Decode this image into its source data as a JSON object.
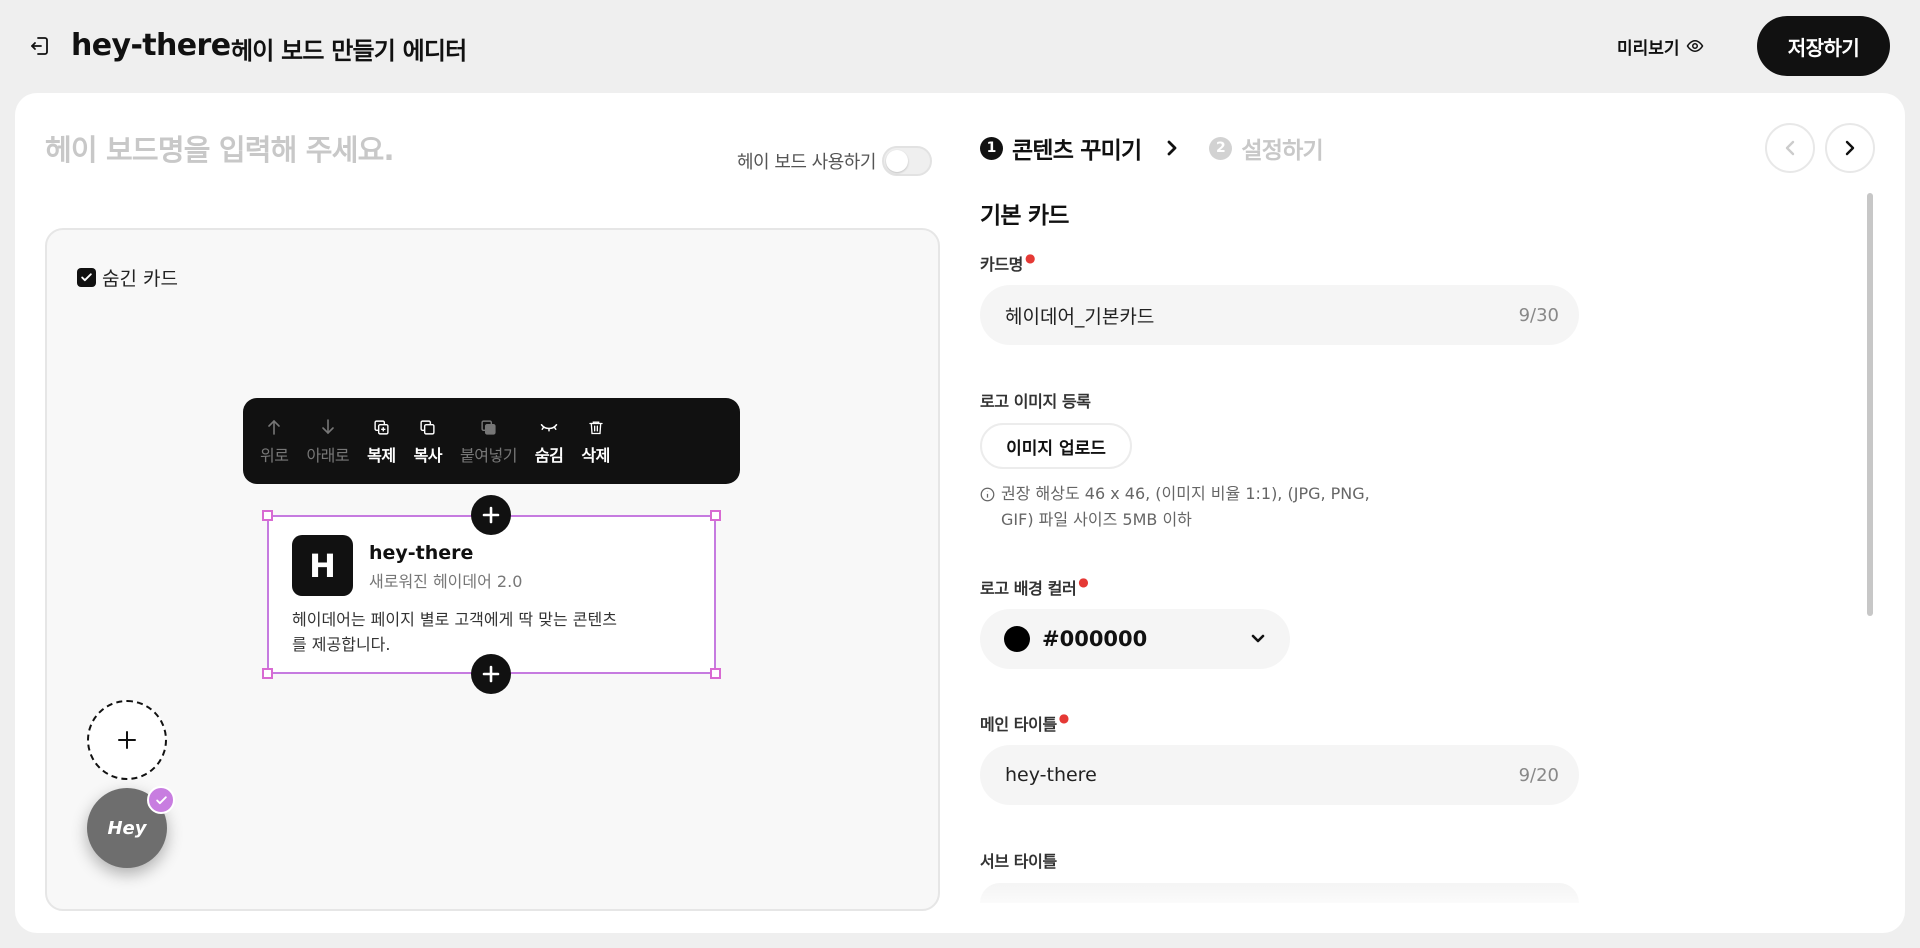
{
  "header": {
    "brand": "hey-there",
    "editor_title": "헤이 보드 만들기 에디터",
    "preview_label": "미리보기",
    "save_label": "저장하기"
  },
  "board": {
    "name_placeholder": "헤이 보드명을 입력해 주세요.",
    "use_label": "헤이 보드 사용하기",
    "use_enabled": false
  },
  "canvas": {
    "hidden_card_label": "숨긴 카드",
    "hidden_card_checked": true,
    "toolbar": [
      {
        "label": "위로",
        "icon": "arrow-up-icon",
        "enabled": false
      },
      {
        "label": "아래로",
        "icon": "arrow-down-icon",
        "enabled": false
      },
      {
        "label": "복제",
        "icon": "duplicate-icon",
        "enabled": true
      },
      {
        "label": "복사",
        "icon": "copy-icon",
        "enabled": true
      },
      {
        "label": "붙여넣기",
        "icon": "paste-icon",
        "enabled": false
      },
      {
        "label": "숨김",
        "icon": "eye-closed-icon",
        "enabled": true
      },
      {
        "label": "삭제",
        "icon": "trash-icon",
        "enabled": true
      }
    ],
    "card": {
      "logo_letter": "H",
      "title": "hey-there",
      "subtitle": "새로워진 헤이데어 2.0",
      "description": "헤이데어는 페이지 별로 고객에게 딱 맞는 콘텐츠를 제공합니다."
    },
    "fab_label": "Hey"
  },
  "steps": [
    {
      "num": "1",
      "label": "콘텐츠 꾸미기",
      "active": true
    },
    {
      "num": "2",
      "label": "설정하기",
      "active": false
    }
  ],
  "form": {
    "section_title": "기본 카드",
    "card_name": {
      "label": "카드명",
      "value": "헤이데어_기본카드",
      "count": "9/30"
    },
    "logo_image": {
      "label": "로고 이미지 등록",
      "upload_label": "이미지 업로드",
      "hint": "권장 해상도 46 x 46, (이미지 비율 1:1), (JPG, PNG, GIF) 파일 사이즈 5MB 이하"
    },
    "logo_bg_color": {
      "label": "로고 배경 컬러",
      "value": "#000000"
    },
    "main_title": {
      "label": "메인 타이틀",
      "value": "hey-there",
      "count": "9/20"
    },
    "sub_title": {
      "label": "서브 타이틀"
    }
  },
  "colors": {
    "accent": "#111111",
    "selection": "#c67be0",
    "required": "#e53935"
  }
}
